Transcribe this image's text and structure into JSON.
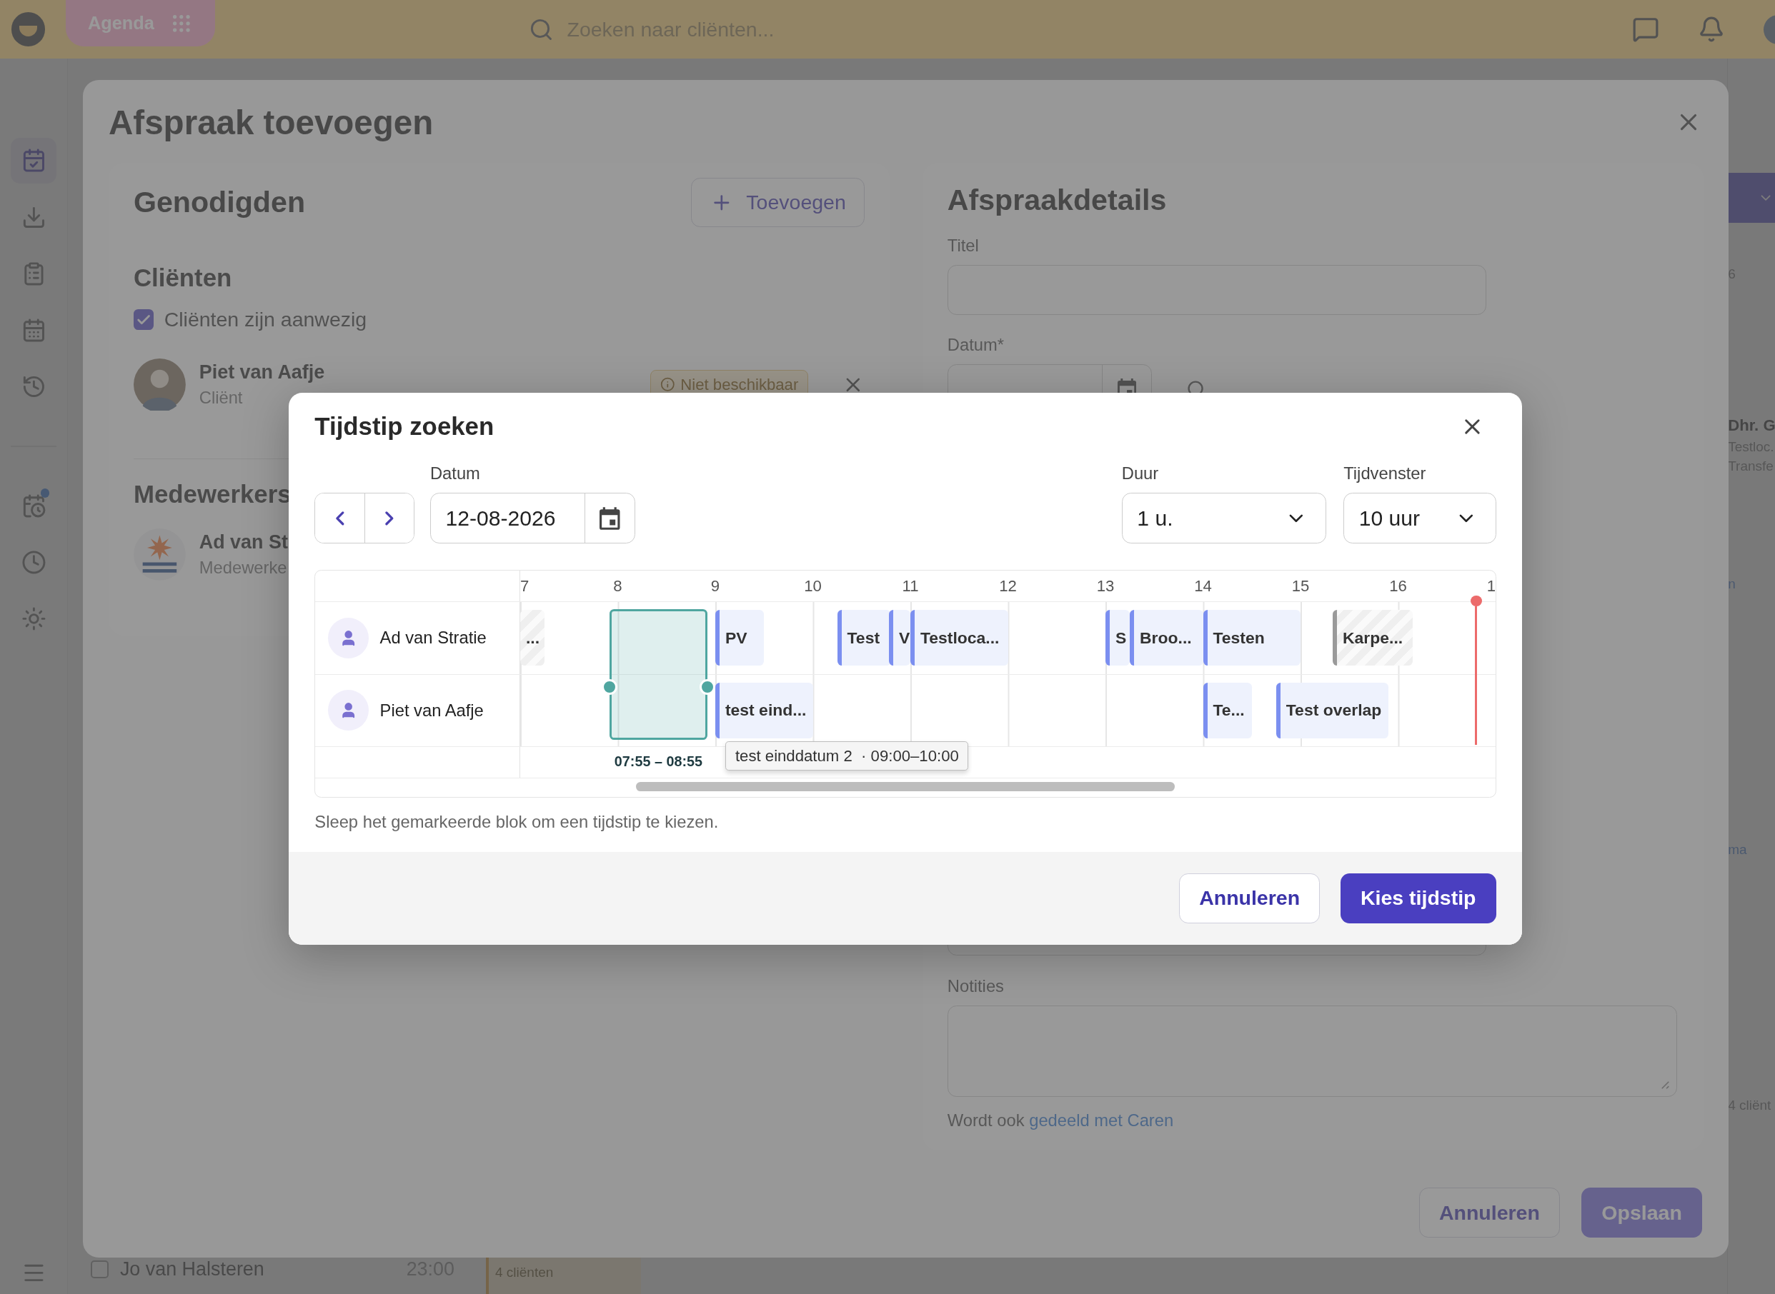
{
  "top_bar": {
    "app_button": "Agenda",
    "search": {
      "placeholder": "Zoeken naar cliënten..."
    }
  },
  "sidebar": {
    "items": [
      {
        "selected": true,
        "badge": false
      },
      {
        "selected": false,
        "badge": false
      },
      {
        "selected": false,
        "badge": false
      },
      {
        "selected": false,
        "badge": false
      },
      {
        "selected": false,
        "badge": false
      },
      {
        "selected": false,
        "badge": true
      },
      {
        "selected": false,
        "badge": false
      },
      {
        "selected": false,
        "badge": false
      }
    ]
  },
  "background": {
    "side_column": [
      {
        "text": "6",
        "kind": "plain"
      },
      {
        "text": "Dhr. G",
        "kind": "name"
      },
      {
        "text": "Testloc.",
        "kind": "meta"
      },
      {
        "text": "Transfe",
        "kind": "meta"
      },
      {
        "text": "n",
        "kind": "link"
      },
      {
        "text": "ma",
        "kind": "link"
      },
      {
        "text": "4 cliënt",
        "kind": "meta"
      }
    ],
    "row": {
      "checked": false,
      "name": "Jo van Halsteren",
      "time": "23:00",
      "event": "4 cliënten"
    }
  },
  "modal": {
    "title": "Afspraak toevoegen",
    "invitees": {
      "title": "Genodigden",
      "add_button": "Toevoegen",
      "clients": {
        "title": "Cliënten",
        "present": {
          "label": "Cliënten zijn aanwezig",
          "checked": true
        },
        "people": [
          {
            "name": "Piet van Aafje",
            "role": "Cliënt",
            "badge": "Niet beschikbaar"
          }
        ]
      },
      "staff": {
        "title": "Medewerkers",
        "people": [
          {
            "name": "Ad van St",
            "role": "Medewerke"
          }
        ]
      }
    },
    "details": {
      "title": "Afspraakdetails",
      "title_label": "Titel",
      "date_label": "Datum*",
      "notes_label": "Notities",
      "share_text": "Wordt ook",
      "share_link": "gedeeld met Caren"
    },
    "buttons": {
      "cancel": "Annuleren",
      "save": "Opslaan"
    }
  },
  "dialog": {
    "title": "Tijdstip zoeken",
    "date": {
      "label": "Datum",
      "value": "12-08-2026"
    },
    "duration": {
      "label": "Duur",
      "value": "1 u."
    },
    "window": {
      "label": "Tijdvenster",
      "value": "10 uur"
    },
    "timeline": {
      "hours": [
        "7",
        "8",
        "9",
        "10",
        "11",
        "12",
        "13",
        "14",
        "15",
        "16",
        "1"
      ],
      "rows": [
        {
          "name": "Ad van Stratie",
          "events": [
            {
              "label": "...",
              "kind": "unavailable"
            },
            {
              "label": "PV",
              "kind": "appointment"
            },
            {
              "label": "Test",
              "kind": "appointment"
            },
            {
              "label": "V",
              "kind": "appointment"
            },
            {
              "label": "Testloca...",
              "kind": "appointment"
            },
            {
              "label": "S",
              "kind": "appointment"
            },
            {
              "label": "Broo...",
              "kind": "appointment"
            },
            {
              "label": "Testen",
              "kind": "appointment"
            },
            {
              "label": "Karpe...",
              "kind": "unavailable"
            }
          ]
        },
        {
          "name": "Piet van Aafje",
          "events": [
            {
              "label": "test eind...",
              "kind": "appointment",
              "tooltip": "test einddatum 2  · 09:00–10:00"
            },
            {
              "label": "Te...",
              "kind": "appointment"
            },
            {
              "label": "Test overlap",
              "kind": "appointment"
            }
          ]
        }
      ],
      "selection": {
        "label": "07:55 – 08:55"
      }
    },
    "hint": "Sleep het gemarkeerde blok om een tijdstip te kiezen.",
    "buttons": {
      "cancel": "Annuleren",
      "confirm": "Kies tijdstip"
    }
  }
}
